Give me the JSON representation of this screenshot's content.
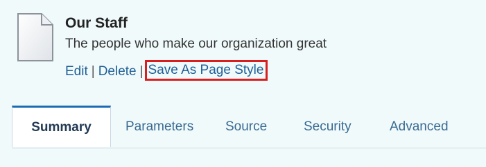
{
  "header": {
    "title": "Our Staff",
    "subtitle": "The people who make our organization great",
    "icon": "page-document-icon"
  },
  "actions": {
    "edit_label": "Edit",
    "delete_label": "Delete",
    "save_style_label": "Save As Page Style",
    "separator": "|"
  },
  "tabs": [
    {
      "label": "Summary",
      "active": true
    },
    {
      "label": "Parameters",
      "active": false
    },
    {
      "label": "Source",
      "active": false
    },
    {
      "label": "Security",
      "active": false
    },
    {
      "label": "Advanced",
      "active": false
    }
  ],
  "colors": {
    "background": "#f0fafb",
    "link": "#1f5e96",
    "highlight_border": "#d81e1e",
    "active_tab_border": "#1a6bb3"
  }
}
